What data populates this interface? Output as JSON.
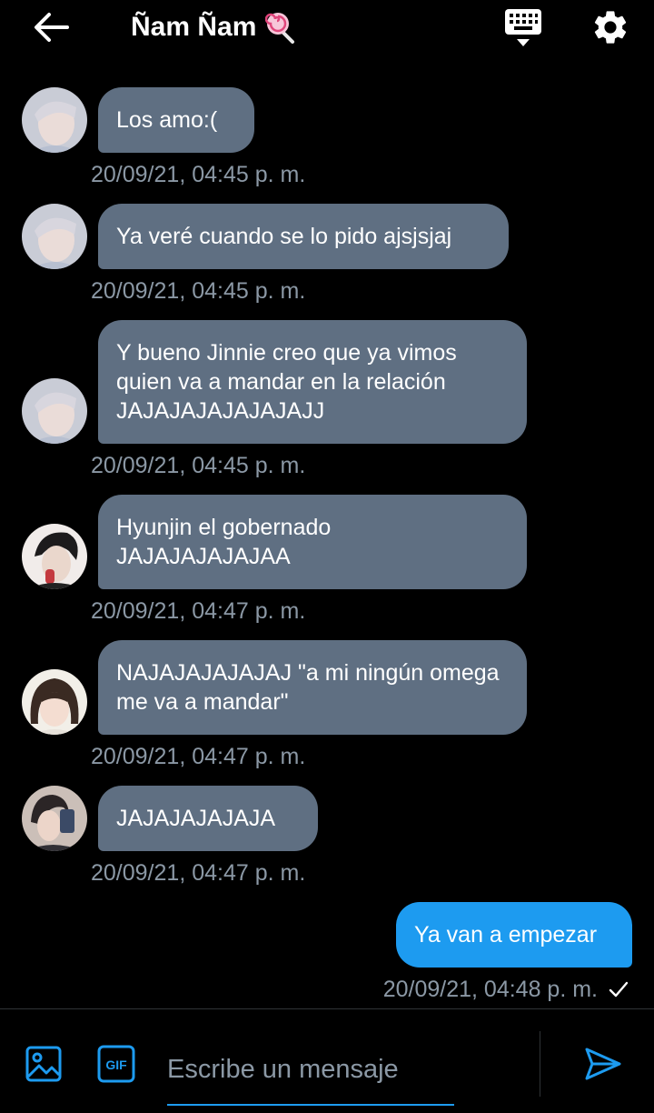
{
  "header": {
    "title": "Ñam Ñam",
    "back_icon": "arrow-left-icon",
    "keyboard_icon": "keyboard-icon",
    "settings_icon": "gear-icon"
  },
  "messages": [
    {
      "direction": "in",
      "text": "Los amo:(",
      "time": "20/09/21, 04:45 p. m."
    },
    {
      "direction": "in",
      "text": "Ya veré cuando se lo pido ajsjsjaj",
      "time": "20/09/21, 04:45 p. m."
    },
    {
      "direction": "in",
      "text": "Y bueno Jinnie creo que ya vimos quien va a mandar en la relación JAJAJAJAJAJAJAJJ",
      "time": "20/09/21, 04:45 p. m."
    },
    {
      "direction": "in",
      "text": "Hyunjin el gobernado JAJAJAJAJAJAA",
      "time": "20/09/21, 04:47 p. m."
    },
    {
      "direction": "in",
      "text": "NAJAJAJAJAJAJ \"a mi ningún omega me va a mandar\"",
      "time": "20/09/21, 04:47 p. m."
    },
    {
      "direction": "in",
      "text": "JAJAJAJAJAJA",
      "time": "20/09/21, 04:47 p. m."
    },
    {
      "direction": "out",
      "text": "Ya van a empezar",
      "time": "20/09/21, 04:48 p. m.",
      "status": "sent"
    }
  ],
  "composer": {
    "placeholder": "Escribe un mensaje",
    "gif_label": "GIF"
  },
  "colors": {
    "background": "#000000",
    "incoming_bubble": "#5f6f82",
    "outgoing_bubble": "#1d9bf0",
    "timestamp": "#8b98a5",
    "accent": "#1d9bf0"
  }
}
